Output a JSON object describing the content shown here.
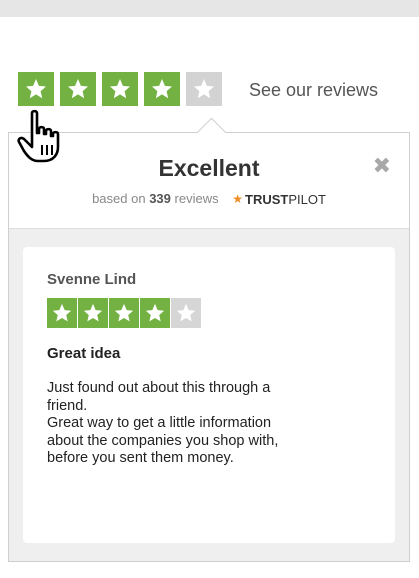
{
  "widget": {
    "rating_stars": 4,
    "max_stars": 5,
    "see_reviews_label": "See our reviews",
    "star_on_color": "#73b143",
    "star_off_color": "#d3d3d3"
  },
  "popup": {
    "title": "Excellent",
    "close_icon": "close-icon",
    "based_prefix": "based on",
    "review_count": "339",
    "based_suffix": "reviews",
    "brand_trust": "TRUST",
    "brand_pilot": "PILOT"
  },
  "review": {
    "reviewer": "Svenne Lind",
    "rating_stars": 4,
    "max_stars": 5,
    "title": "Great idea",
    "lines": [
      "Just found out about this through a",
      "friend.",
      "Great way to get a little information",
      "about the companies you shop with,",
      "before you sent them money."
    ]
  },
  "cursor": {
    "icon": "hand-pointer-icon"
  }
}
